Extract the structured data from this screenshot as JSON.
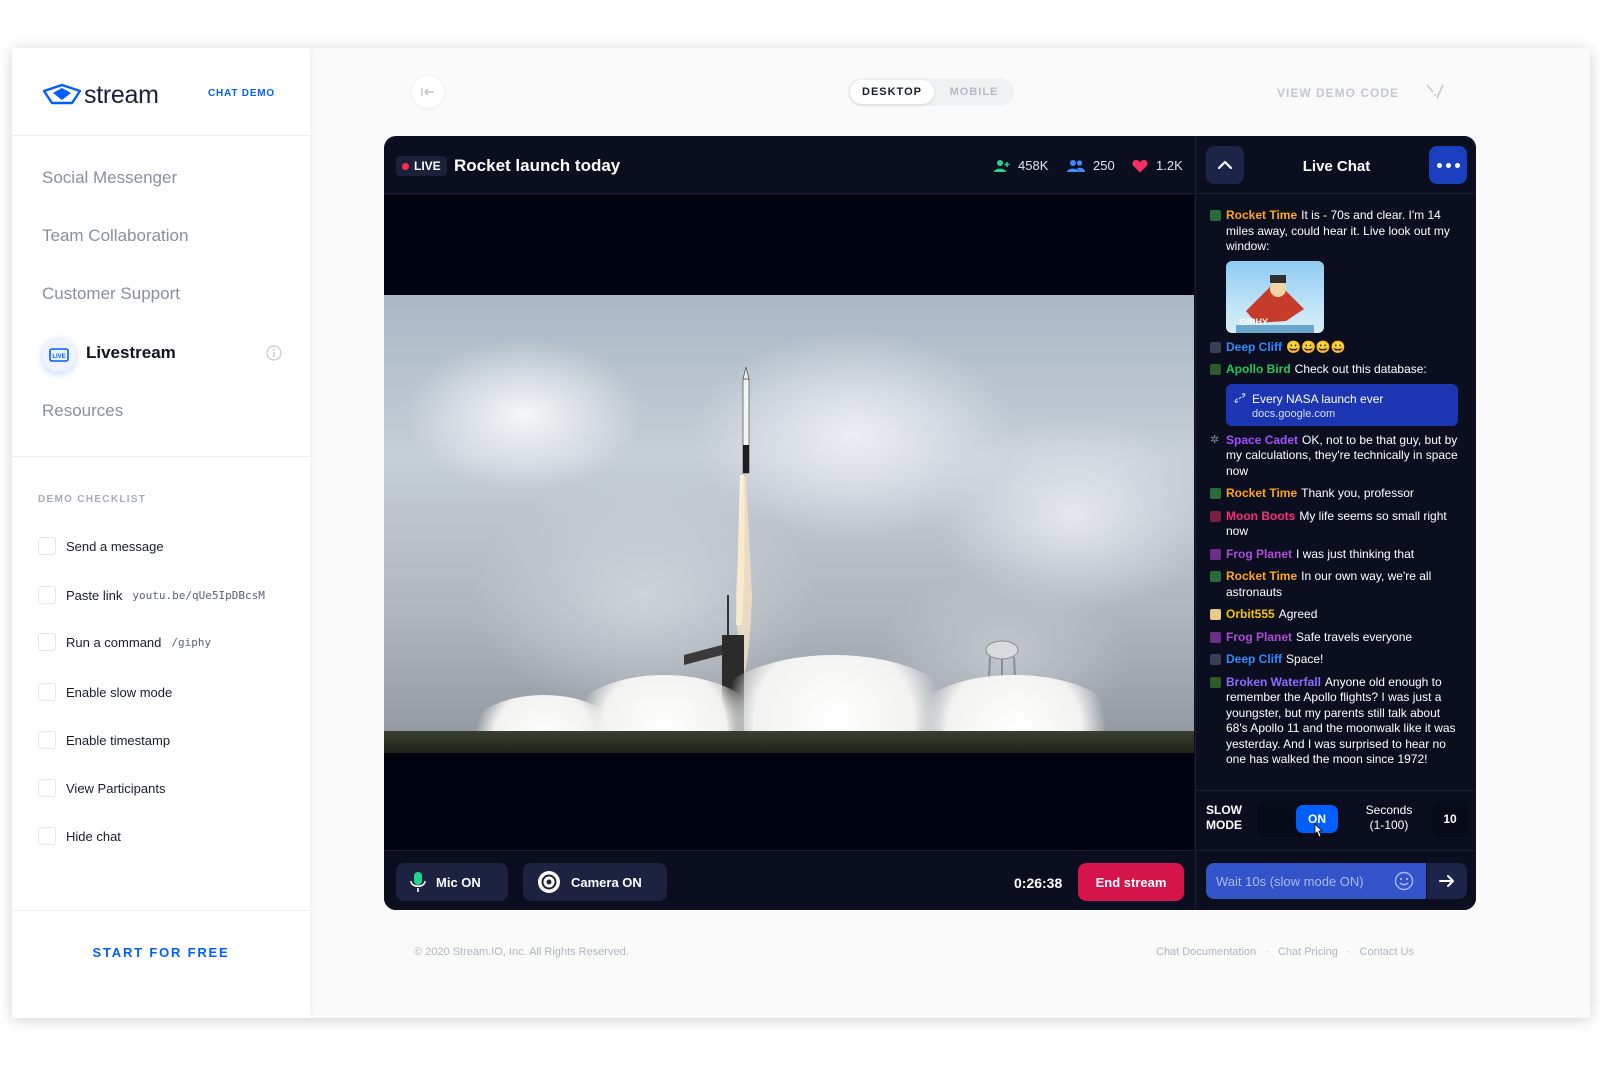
{
  "brand": {
    "name": "stream",
    "tag": "CHAT DEMO"
  },
  "sidebar": {
    "nav": [
      {
        "label": "Social Messenger"
      },
      {
        "label": "Team Collaboration"
      },
      {
        "label": "Customer Support"
      },
      {
        "label": "Livestream",
        "active": true
      },
      {
        "label": "Resources"
      }
    ],
    "checklist_title": "DEMO CHECKLIST",
    "checklist": [
      {
        "label": "Send a message",
        "code": ""
      },
      {
        "label": "Paste link",
        "code": "youtu.be/qUe5IpDBcsM"
      },
      {
        "label": "Run a command",
        "code": "/giphy"
      },
      {
        "label": "Enable slow mode",
        "code": ""
      },
      {
        "label": "Enable timestamp",
        "code": ""
      },
      {
        "label": "View Participants",
        "code": ""
      },
      {
        "label": "Hide chat",
        "code": ""
      }
    ],
    "start_label": "START FOR FREE"
  },
  "topbar": {
    "view_options": [
      "DESKTOP",
      "MOBILE"
    ],
    "selected_view": "DESKTOP",
    "view_code_label": "VIEW DEMO CODE"
  },
  "stream": {
    "live_label": "LIVE",
    "title": "Rocket launch today",
    "stats": {
      "followers": "458K",
      "viewers": "250",
      "likes": "1.2K"
    },
    "controls": {
      "mic_label": "Mic ON",
      "camera_label": "Camera ON",
      "timer": "0:26:38",
      "end_label": "End stream"
    }
  },
  "chat": {
    "title": "Live Chat",
    "messages": [
      {
        "user": "Rocket Time",
        "color": "#ffa51c",
        "text": "It is - 70s and clear. I'm 14 miles away, could hear it. Live look out my window:",
        "gif": "GIPHY"
      },
      {
        "user": "Deep Cliff",
        "color": "#2b8bff",
        "text": "😀😀😀😀"
      },
      {
        "user": "Apollo Bird",
        "color": "#20c85a",
        "text": "Check out this database:",
        "link_title": "Every NASA launch ever",
        "link_url": "docs.google.com"
      },
      {
        "user": "Space Cadet",
        "color": "#a64dff",
        "text": "OK, not to be that guy, but by my calculations, they're technically in space now"
      },
      {
        "user": "Rocket Time",
        "color": "#ffa51c",
        "text": "Thank you, professor"
      },
      {
        "user": "Moon Boots",
        "color": "#ff2d75",
        "text": "My life seems so small right now"
      },
      {
        "user": "Frog Planet",
        "color": "#b14cd8",
        "text": "I was just thinking that"
      },
      {
        "user": "Rocket Time",
        "color": "#ffa51c",
        "text": "In our own way, we're all astronauts"
      },
      {
        "user": "Orbit555",
        "color": "#f5c400",
        "text": "Agreed"
      },
      {
        "user": "Frog Planet",
        "color": "#b14cd8",
        "text": "Safe travels everyone"
      },
      {
        "user": "Deep Cliff",
        "color": "#2b8bff",
        "text": "Space!"
      },
      {
        "user": "Broken Waterfall",
        "color": "#8b6cff",
        "text": "Anyone old enough to remember the Apollo flights? I was just a youngster, but my parents still talk about 68's Apollo 11 and the moonwalk like it was yesterday.  And I was surprised to hear no one has walked the moon since 1972!"
      }
    ],
    "slow_mode": {
      "label_line1": "SLOW",
      "label_line2": "MODE",
      "state": "ON",
      "seconds_line1": "Seconds",
      "seconds_line2": "(1-100)",
      "seconds_value": "10"
    },
    "input_placeholder": "Wait 10s (slow mode ON)"
  },
  "footer": {
    "copyright": "© 2020 Stream.IO, Inc. All Rights Reserved.",
    "links": [
      "Chat Documentation",
      "Chat Pricing",
      "Contact Us"
    ]
  }
}
